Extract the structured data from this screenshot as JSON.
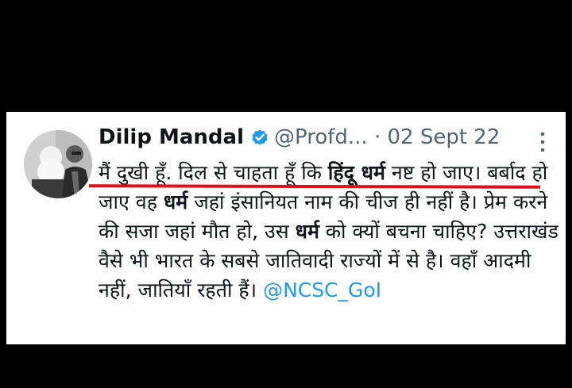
{
  "tweet": {
    "author_name": "Dilip Mandal",
    "handle": "@Profd...",
    "separator": "·",
    "date": "02 Sept 22",
    "text_line1_a": "मैं दुखी हूँ. दिल से चाहता हूँ कि ",
    "text_line1_bold": "हिंदू धर्म",
    "text_line1_b": " नष्ट हो जाए।",
    "text_line2_a": "बर्बाद हो जाए वह ",
    "text_line2_bold": "धर्म",
    "text_line2_b": " जहां इंसानियत नाम की चीज ही नहीं है। प्रेम करने की सजा जहां मौत हो, उस ",
    "text_line3_bold": "धर्म",
    "text_line3_b": " को क्यों बचना चाहिए? उत्तराखंड वैसे भी भारत के सबसे जातिवादी राज्यों में से है। वहाँ आदमी नहीं, जातियाँ रहती हैं। ",
    "mention": "@NCSC_GoI"
  },
  "icons": {
    "verified": "verified-badge-icon",
    "more": "more-options-icon"
  },
  "colors": {
    "background": "#000000",
    "card": "#ffffff",
    "text": "#0f1419",
    "muted": "#536471",
    "link": "#1d9bf0",
    "annotation": "#e0101a"
  }
}
